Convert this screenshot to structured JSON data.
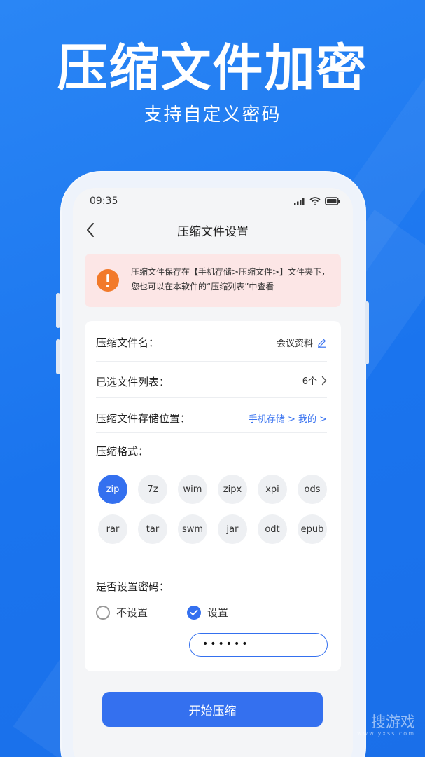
{
  "promo": {
    "headline": "压缩文件加密",
    "subline": "支持自定义密码"
  },
  "status_bar": {
    "time": "09:35",
    "icons": [
      "signal-icon",
      "wifi-icon",
      "battery-icon"
    ]
  },
  "nav": {
    "title": "压缩文件设置",
    "back_icon": "chevron-left-icon"
  },
  "notice": {
    "icon": "warning-icon",
    "line1": "压缩文件保存在【手机存储>压缩文件>】文件夹下，",
    "line2": "您也可以在本软件的“压缩列表”中查看"
  },
  "settings": {
    "file_name": {
      "label": "压缩文件名：",
      "value": "会议资料"
    },
    "selected_files": {
      "label": "已选文件列表：",
      "value": "6个"
    },
    "location": {
      "label": "压缩文件存储位置：",
      "value": "手机存储 > 我的 >"
    },
    "format": {
      "label": "压缩格式：",
      "options": [
        "zip",
        "7z",
        "wim",
        "zipx",
        "xpi",
        "ods",
        "rar",
        "tar",
        "swm",
        "jar",
        "odt",
        "epub"
      ],
      "selected": "zip"
    },
    "password": {
      "label": "是否设置密码：",
      "option_off": "不设置",
      "option_on": "设置",
      "selected": "设置",
      "value": "••••••"
    }
  },
  "actions": {
    "start": "开始压缩"
  },
  "watermark": {
    "main": "搜游戏",
    "sub": "www.yxss.com"
  },
  "colors": {
    "accent": "#3470ef",
    "background": "#1f7bf2",
    "warning": "#f27a2a",
    "notice_bg": "#fce6e6"
  }
}
